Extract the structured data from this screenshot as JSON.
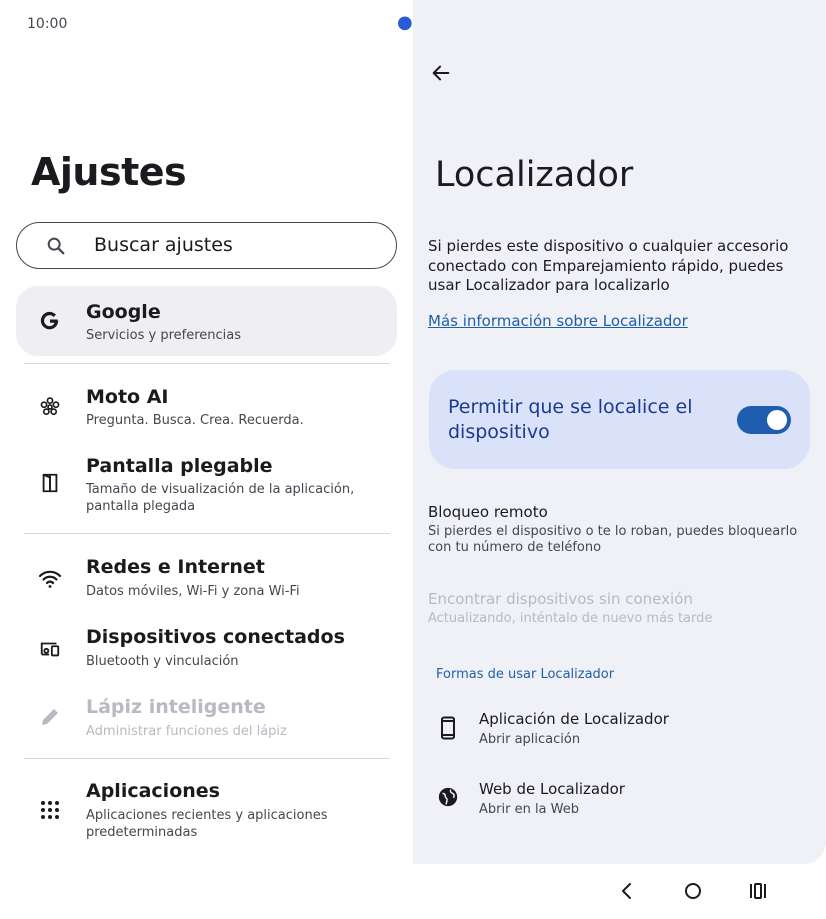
{
  "status_bar": {
    "time": "10:00"
  },
  "settings": {
    "title": "Ajustes",
    "search_placeholder": "Buscar ajustes",
    "items": [
      {
        "title": "Google",
        "subtitle": "Servicios y preferencias",
        "icon": "google-g-icon"
      },
      {
        "title": "Moto AI",
        "subtitle": "Pregunta. Busca. Crea. Recuerda.",
        "icon": "moto-ai-icon"
      },
      {
        "title": "Pantalla plegable",
        "subtitle": "Tamaño de visualización de la aplicación, pantalla plegada",
        "icon": "foldable-screen-icon"
      },
      {
        "title": "Redes e Internet",
        "subtitle": "Datos móviles, Wi-Fi y zona Wi-Fi",
        "icon": "wifi-icon"
      },
      {
        "title": "Dispositivos conectados",
        "subtitle": "Bluetooth y vinculación",
        "icon": "connected-devices-icon"
      },
      {
        "title": "Lápiz inteligente",
        "subtitle": "Administrar funciones del lápiz",
        "icon": "pen-icon",
        "disabled": true
      },
      {
        "title": "Aplicaciones",
        "subtitle": "Aplicaciones recientes y aplicaciones predeterminadas",
        "icon": "apps-grid-icon"
      }
    ]
  },
  "finder": {
    "title": "Localizador",
    "description": "Si pierdes este dispositivo o cualquier accesorio conectado con Emparejamiento rápido, puedes usar Localizador para localizarlo",
    "learn_more_link": "Más información sobre Localizador",
    "toggle": {
      "label": "Permitir que se localice el dispositivo",
      "on": true
    },
    "remote_lock": {
      "title": "Bloqueo remoto",
      "subtitle": "Si pierdes el dispositivo o te lo roban, puedes bloquearlo con tu número de teléfono"
    },
    "offline": {
      "title": "Encontrar dispositivos sin conexión",
      "subtitle": "Actualizando, inténtalo de nuevo más tarde",
      "disabled": true
    },
    "section_label": "Formas de usar Localizador",
    "actions": [
      {
        "title": "Aplicación de Localizador",
        "subtitle": "Abrir aplicación",
        "icon": "phone-icon"
      },
      {
        "title": "Web de Localizador",
        "subtitle": "Abrir en la Web",
        "icon": "globe-icon"
      }
    ]
  },
  "colors": {
    "accent": "#1f5db0",
    "card": "#dae2fa",
    "pane_bg": "#f0f1f6"
  }
}
